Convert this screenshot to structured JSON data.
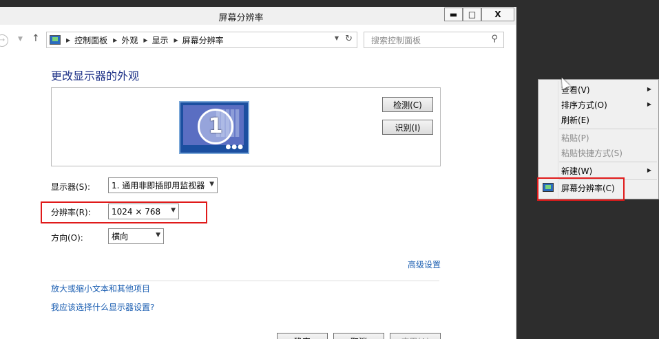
{
  "window": {
    "title": "屏幕分辨率",
    "min_glyph": "▬",
    "max_glyph": "□",
    "close_glyph": "X"
  },
  "nav": {
    "breadcrumbs": [
      "控制面板",
      "外观",
      "显示",
      "屏幕分辨率"
    ],
    "search_placeholder": "搜索控制面板"
  },
  "content": {
    "heading": "更改显示器的外观",
    "monitor_number": "1",
    "detect_label": "检测(C)",
    "identify_label": "识别(I)",
    "display_label": "显示器(S):",
    "display_value": "1. 通用非即插即用监视器",
    "resolution_label": "分辨率(R):",
    "resolution_value": "1024 × 768",
    "orientation_label": "方向(O):",
    "orientation_value": "横向",
    "advanced_link": "高级设置",
    "link_text_size": "放大或缩小文本和其他项目",
    "link_which_settings": "我应该选择什么显示器设置?",
    "ok_label": "确定",
    "cancel_label": "取消",
    "apply_label": "应用(A)"
  },
  "context_menu": {
    "items": [
      {
        "label": "查看(V)",
        "submenu": true,
        "disabled": false
      },
      {
        "label": "排序方式(O)",
        "submenu": true,
        "disabled": false
      },
      {
        "label": "刷新(E)",
        "submenu": false,
        "disabled": false
      },
      {
        "label": "粘贴(P)",
        "submenu": false,
        "disabled": true
      },
      {
        "label": "粘贴快捷方式(S)",
        "submenu": false,
        "disabled": true
      },
      {
        "label": "新建(W)",
        "submenu": true,
        "disabled": false
      },
      {
        "label": "屏幕分辨率(C)",
        "submenu": false,
        "disabled": false
      }
    ]
  },
  "colors": {
    "highlight_box": "#e01a1a",
    "link": "#1c5fb2",
    "heading": "#1e3287",
    "desktop": "#2d2d2d"
  }
}
